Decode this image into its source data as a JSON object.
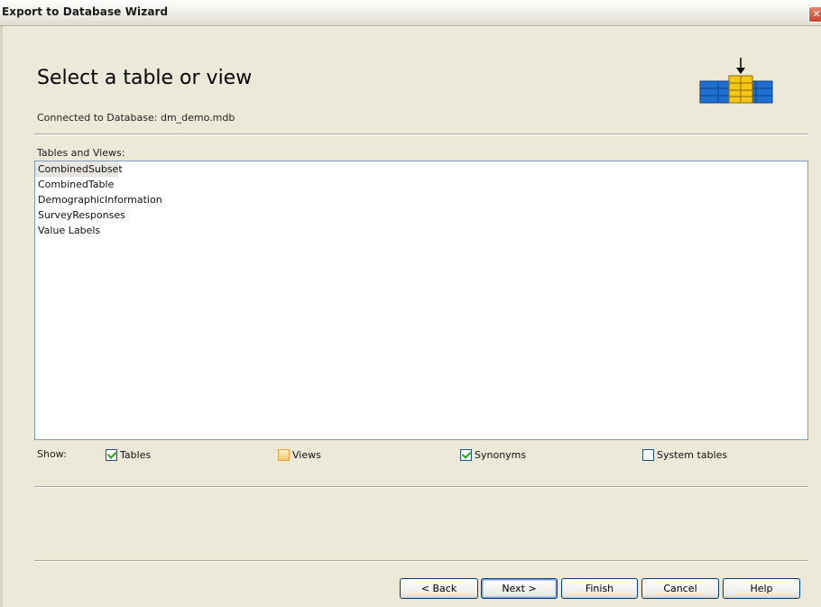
{
  "window": {
    "title": "Export to Database Wizard"
  },
  "page": {
    "heading": "Select a table or view",
    "connected": "Connected to Database: dm_demo.mdb",
    "tables_label": "Tables and Views:"
  },
  "list": {
    "items": [
      "CombinedSubset",
      "CombinedTable",
      "DemographicInformation",
      "SurveyResponses",
      "Value Labels"
    ],
    "selected_index": 0
  },
  "show": {
    "label": "Show:",
    "options": [
      {
        "label": "Tables",
        "checked": true
      },
      {
        "label": "Views",
        "checked": false
      },
      {
        "label": "Synonyms",
        "checked": true
      },
      {
        "label": "System tables",
        "checked": false
      }
    ]
  },
  "buttons": {
    "back": "< Back",
    "next": "Next >",
    "finish": "Finish",
    "cancel": "Cancel",
    "help": "Help"
  },
  "colors": {
    "icon_blue": "#1f6fd1",
    "icon_yellow": "#f5c518",
    "check_green": "#21a121"
  }
}
